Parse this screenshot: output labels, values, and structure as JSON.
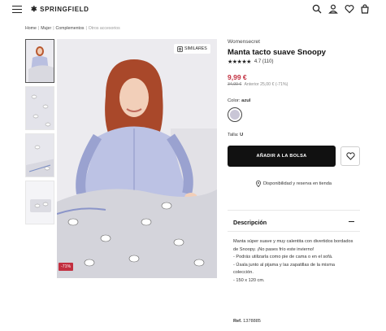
{
  "header": {
    "logo": "SPRINGFIELD",
    "icons": [
      "menu-icon",
      "search-icon",
      "user-icon",
      "heart-icon",
      "bag-icon"
    ]
  },
  "breadcrumb": {
    "items": [
      "Home",
      "Mujer",
      "Complementos",
      "Otros accesorios"
    ],
    "separator": "|"
  },
  "gallery": {
    "similares_label": "SIMILARES",
    "discount_badge": "-71%"
  },
  "product": {
    "brand": "Womensecret",
    "title": "Manta tacto suave Snoopy",
    "rating_value": "4.7",
    "rating_count": "(110)",
    "rating_stars": 4.5,
    "price": "9,99 €",
    "old_price": "34,99 €",
    "previous_price_text": "Anterior 25,00 € (-71%)",
    "color_label": "Color:",
    "color_value": "azul",
    "size_label": "Talla:",
    "size_value": "U",
    "add_to_bag": "AÑADIR A LA BOLSA",
    "availability": "Disponibilidad y reserva en tienda"
  },
  "description": {
    "title": "Descripción",
    "lines": [
      "Manta súper suave y muy calentita con divertidos bordados de Snoopy. ¡No pases frío este invierno!",
      "- Podrás utilizarla como pie de cama o en el sofá.",
      "- Úsala junto al pijama y las zapatillas de la misma colección.",
      "- 150 x 120 cm."
    ],
    "ref_label": "Ref.",
    "ref_value": "1378885"
  },
  "colors": {
    "accent_red": "#c22f3f",
    "button_black": "#111111"
  }
}
